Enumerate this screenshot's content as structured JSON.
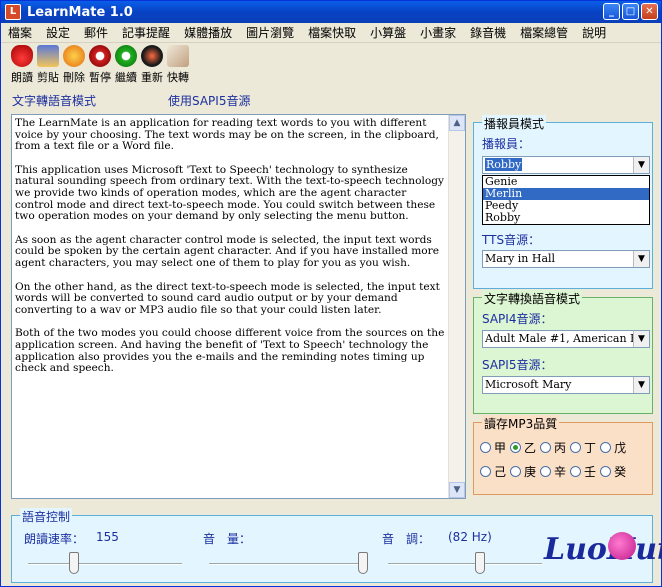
{
  "window": {
    "title": "LearnMate 1.0"
  },
  "menu": [
    "檔案",
    "設定",
    "郵件",
    "記事提醒",
    "媒體播放",
    "圖片瀏覽",
    "檔案快取",
    "小算盤",
    "小畫家",
    "錄音機",
    "檔案總管",
    "說明"
  ],
  "toolbar": [
    {
      "label": "朗讀",
      "icon": "lips-icon"
    },
    {
      "label": "剪貼",
      "icon": "clipboard-icon"
    },
    {
      "label": "刪除",
      "icon": "delete-icon"
    },
    {
      "label": "暫停",
      "icon": "pause-icon"
    },
    {
      "label": "繼續",
      "icon": "continue-icon"
    },
    {
      "label": "重新",
      "icon": "restart-icon"
    },
    {
      "label": "快轉",
      "icon": "fast-forward-icon"
    }
  ],
  "mode": {
    "left": "文字轉語音模式",
    "right": "使用SAPI5音源"
  },
  "text": {
    "p1": "The LearnMate is an application for reading text words to you with different voice by your choosing. The text words may be on the screen, in the clipboard, from a text file or a Word file.",
    "p2": "This application uses Microsoft 'Text to Speech' technology to synthesize natural sounding speech from ordinary text. With the text-to-speech technology we provide two kinds of operation modes, which are the agent character control mode and direct text-to-speech mode. You could switch between these two operation modes on your demand by only selecting the menu button.",
    "p3": "As soon as the agent character control mode is selected, the input text words could be spoken by the certain agent character. And if you have installed more agent characters, you may select one of them to play for you as you wish.",
    "p4": "On the other hand, as the direct text-to-speech mode is selected, the input text words will be converted to sound card audio output or by your demand converting to a wav or MP3 audio file so that your could listen later.",
    "p5": "Both of the two modes you could choose different voice from the sources on the application screen. And having the benefit of 'Text to Speech' technology the application also provides you the e-mails and the reminding notes timing up check and speech."
  },
  "broadcaster": {
    "title": "播報員模式",
    "label": "播報員：",
    "value": "Robby",
    "options": [
      "Genie",
      "Merlin",
      "Peedy",
      "Robby"
    ],
    "highlighted": "Merlin",
    "tts_label": "TTS音源：",
    "tts_value": "Mary in Hall"
  },
  "tts_mode": {
    "title": "文字轉換語音模式",
    "sapi4_label": "SAPI4音源：",
    "sapi4_value": "Adult Male #1, American Engli",
    "sapi5_label": "SAPI5音源：",
    "sapi5_value": "Microsoft Mary"
  },
  "mp3": {
    "title": "讀存MP3品質",
    "row1": [
      "甲",
      "乙",
      "丙",
      "丁",
      "戊"
    ],
    "row2": [
      "己",
      "庚",
      "辛",
      "壬",
      "癸"
    ],
    "selected": "乙"
  },
  "voice_control": {
    "title": "語音控制",
    "rate_label": "朗讀速率：",
    "rate_value": "155",
    "volume_label": "音　量：",
    "pitch_label": "音　調：",
    "pitch_value": "(82 Hz)",
    "logo": "LuoHui",
    "rate_level": 0.3,
    "volume_level": 1.0,
    "pitch_level": 0.6
  },
  "colors": {
    "titlebar": "#0a5fe8",
    "label_blue": "#1c2fa0",
    "highlight": "#316ac5"
  }
}
